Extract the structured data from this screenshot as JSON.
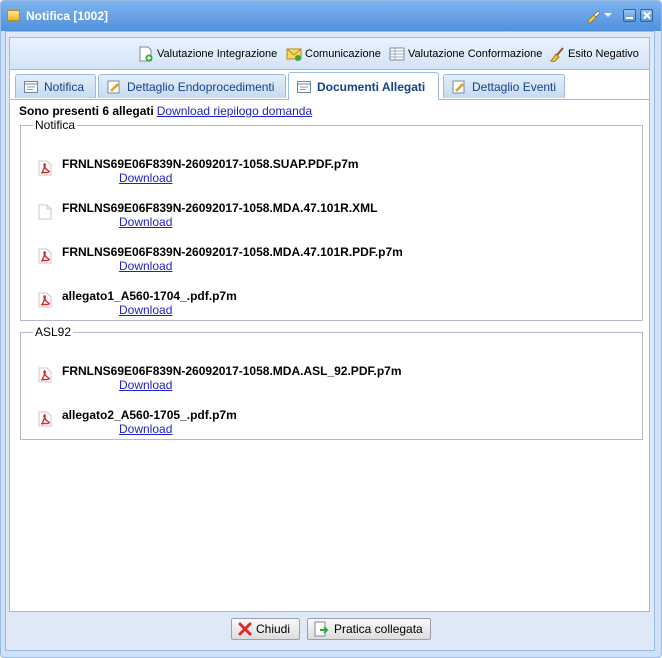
{
  "window": {
    "title": "Notifica [1002]"
  },
  "toolbar": {
    "valutazione_integrazione": "Valutazione Integrazione",
    "comunicazione": "Comunicazione",
    "valutazione_conformazione": "Valutazione Conformazione",
    "esito_negativo": "Esito Negativo"
  },
  "tabs": [
    {
      "label": "Notifica"
    },
    {
      "label": "Dettaglio Endoprocedimenti"
    },
    {
      "label": "Documenti Allegati"
    },
    {
      "label": "Dettaglio Eventi"
    }
  ],
  "info": {
    "text": "Sono presenti 6 allegati",
    "link": "Download riepilogo domanda"
  },
  "groups": [
    {
      "legend": "Notifica",
      "files": [
        {
          "name": "FRNLNS69E06F839N-26092017-1058.SUAP.PDF.p7m",
          "link": "Download",
          "icon": "pdf-icon"
        },
        {
          "name": "FRNLNS69E06F839N-26092017-1058.MDA.47.101R.XML",
          "link": "Download",
          "icon": "file-icon"
        },
        {
          "name": "FRNLNS69E06F839N-26092017-1058.MDA.47.101R.PDF.p7m",
          "link": "Download",
          "icon": "pdf-icon"
        },
        {
          "name": "allegato1_A560-1704_.pdf.p7m",
          "link": "Download",
          "icon": "pdf-icon"
        }
      ]
    },
    {
      "legend": "ASL92",
      "files": [
        {
          "name": "FRNLNS69E06F839N-26092017-1058.MDA.ASL_92.PDF.p7m",
          "link": "Download",
          "icon": "pdf-icon"
        },
        {
          "name": "allegato2_A560-1705_.pdf.p7m",
          "link": "Download",
          "icon": "pdf-icon"
        }
      ]
    }
  ],
  "footer": {
    "chiudi": "Chiudi",
    "pratica_collegata": "Pratica collegata"
  },
  "colors": {
    "link": "#1e22c4",
    "title_bar": "#5a9ae0",
    "tab_text": "#15428b",
    "pdf_red": "#d92b2b"
  }
}
